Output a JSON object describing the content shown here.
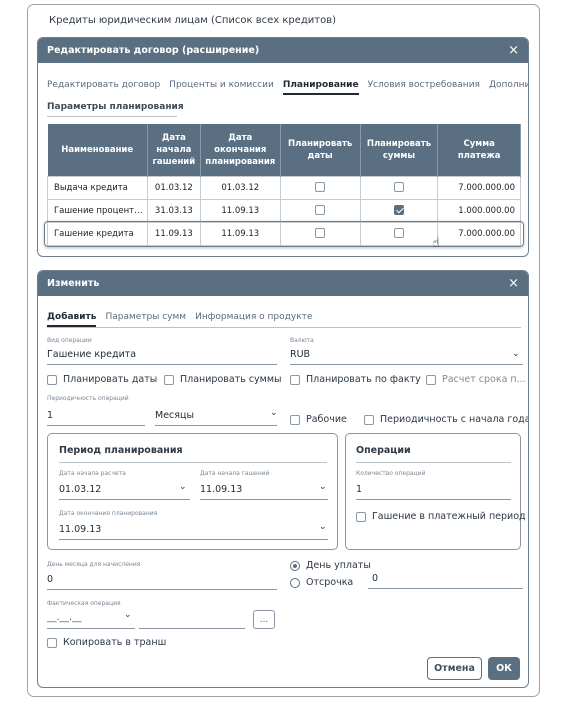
{
  "outer": {
    "title": "Кредиты юридическим лицам (Список всех кредитов)"
  },
  "edit_dialog": {
    "title": "Редактировать договор (расширение)",
    "close": "×",
    "tabs": [
      "Редактировать договор",
      "Проценты и комиссии",
      "Планирование",
      "Условия востребования",
      "Дополни"
    ],
    "active_tab": "Планирование",
    "section": "Параметры планирования",
    "columns": [
      "Наименование",
      "Дата начала гашений",
      "Дата окончания планирования",
      "Планировать даты",
      "Планировать суммы",
      "Сумма платежа"
    ],
    "rows": [
      {
        "name": "Выдача кредита",
        "start": "01.03.12",
        "end": "01.03.12",
        "plan_dates": false,
        "plan_sums": false,
        "amount": "7.000.000.00"
      },
      {
        "name": "Гашение процент…",
        "start": "31.03.13",
        "end": "11.09.13",
        "plan_dates": false,
        "plan_sums": true,
        "amount": "1.000.000.00"
      },
      {
        "name": "Гашение кредита",
        "start": "11.09.13",
        "end": "11.09.13",
        "plan_dates": false,
        "plan_sums": false,
        "amount": "7.000.000.00"
      }
    ]
  },
  "change_dialog": {
    "title": "Изменить",
    "close": "×",
    "tabs": [
      "Добавить",
      "Параметры сумм",
      "Информация о продукте"
    ],
    "active_tab": "Добавить",
    "op_type_label": "Вид операции",
    "op_type_value": "Гашение кредита",
    "currency_label": "Валюта",
    "currency_value": "RUB",
    "checks1": [
      {
        "label": "Планировать даты",
        "checked": false
      },
      {
        "label": "Планировать суммы",
        "checked": false
      },
      {
        "label": "Планировать по факту",
        "checked": false
      },
      {
        "label": "Расчет срока п...",
        "checked": false,
        "muted": true
      }
    ],
    "period_label": "Периодичность операций",
    "period_value": "1",
    "period_unit": "Месяцы",
    "working_days": "Рабочие",
    "period_from_start": "Периодичность с начала года",
    "planning_panel": {
      "title": "Период планирования",
      "calc_start_label": "Дата начала расчета",
      "calc_start_value": "01.03.12",
      "repay_start_label": "Дата начала гашений",
      "repay_start_value": "11.09.13",
      "plan_end_label": "Дата окончания планирования",
      "plan_end_value": "11.09.13"
    },
    "operations_panel": {
      "title": "Операции",
      "count_label": "Количество операций",
      "count_value": "1",
      "repay_in_period": "Гашение в платежный период"
    },
    "day_label": "День месяца для начисления",
    "day_value": "0",
    "radio_pay_day": "День уплаты",
    "radio_delay": "Отсрочка",
    "delay_value": "0",
    "fact_op_label": "Фактическая операция",
    "fact_op_value": "__.__.__",
    "ellipsis": "...",
    "copy_tranche": "Копировать в транш",
    "cancel": "Отмена",
    "ok": "ОК"
  }
}
